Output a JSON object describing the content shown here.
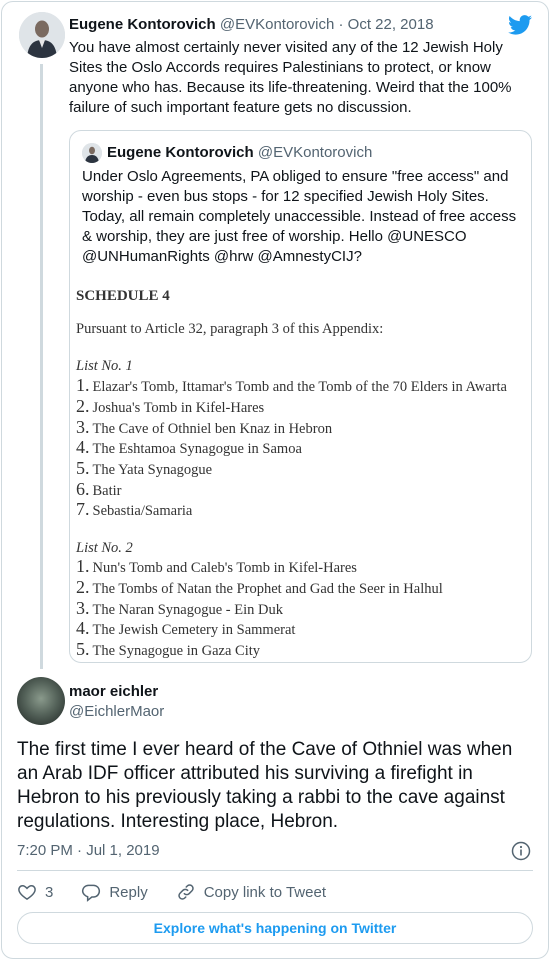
{
  "colors": {
    "accent": "#1d9bf0",
    "secondary_text": "#536471",
    "border": "#cfd9de"
  },
  "parent_tweet": {
    "author_name": "Eugene Kontorovich",
    "author_handle": "@EVKontorovich",
    "separator": "·",
    "date": "Oct 22, 2018",
    "text": "You have almost certainly never visited any of the 12 Jewish Holy Sites the Oslo Accords requires Palestinians to protect, or know anyone who has. Because its life-threatening. Weird that the 100% failure of such important feature gets no discussion."
  },
  "quoted_tweet": {
    "author_name": "Eugene Kontorovich",
    "author_handle": "@EVKontorovich",
    "text": "Under Oslo Agreements, PA obliged to ensure \"free access\" and worship - even bus stops - for 12 specified Jewish Holy Sites. Today, all remain completely unaccessible. Instead of free access & worship, they are just free of worship. Hello @UNESCO @UNHumanRights @hrw @AmnestyCIJ?",
    "document": {
      "heading": "SCHEDULE 4",
      "subheading": "Pursuant to Article 32, paragraph 3 of this Appendix:",
      "list1_title": "List No. 1",
      "list1": [
        {
          "num": "1.",
          "text": "Elazar's Tomb, Ittamar's Tomb and the Tomb of the 70 Elders in Awarta"
        },
        {
          "num": "2.",
          "text": "Joshua's Tomb in Kifel-Hares"
        },
        {
          "num": "3.",
          "text": "The Cave of Othniel ben Knaz in Hebron"
        },
        {
          "num": "4.",
          "text": "The Eshtamoa Synagogue in Samoa"
        },
        {
          "num": "5.",
          "text": "The Yata Synagogue"
        },
        {
          "num": "6.",
          "text": "Batir"
        },
        {
          "num": "7.",
          "text": "Sebastia/Samaria"
        }
      ],
      "list2_title": "List No. 2",
      "list2": [
        {
          "num": "1.",
          "text": "Nun's Tomb and Caleb's Tomb in Kifel-Hares"
        },
        {
          "num": "2.",
          "text": "The Tombs of Natan the Prophet and Gad the Seer in Halhul"
        },
        {
          "num": "3.",
          "text": "The Naran Synagogue - Ein Duk"
        },
        {
          "num": "4.",
          "text": "The Jewish Cemetery in Sammerat"
        },
        {
          "num": "5.",
          "text": "The Synagogue in Gaza City"
        }
      ]
    }
  },
  "reply_tweet": {
    "author_name": "maor eichler",
    "author_handle": "@EichlerMaor",
    "text": "The first time I ever heard of the Cave of Othniel was when an Arab IDF officer attributed his surviving a firefight in Hebron to his previously taking a rabbi to the cave against regulations. Interesting place, Hebron.",
    "timestamp": "7:20 PM · Jul 1, 2019"
  },
  "actions": {
    "like_count": "3",
    "reply_label": "Reply",
    "copy_link_label": "Copy link to Tweet"
  },
  "explore_button": "Explore what's happening on Twitter"
}
